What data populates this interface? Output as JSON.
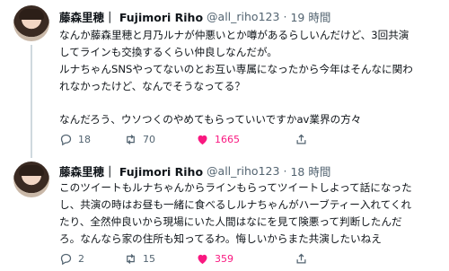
{
  "tweets": [
    {
      "author_name": "藤森里穂｜ Fujimori Riho",
      "handle": "@all_riho123",
      "time": "19 時間",
      "body_lines": [
        "なんか藤森里穂と月乃ルナが仲悪いとか噂があるらしいんだけど、3回共演",
        "してラインも交換するくらい仲良しなんだが。",
        "ルナちゃんSNSやってないのとお互い専属になったから今年はそんなに関わ",
        "れなかったけど、なんでそうなってる？",
        "",
        "なんだろう、ウソつくのやめてもらっていいですかav業界の方々"
      ],
      "replies": "18",
      "retweets": "70",
      "likes": "1665"
    },
    {
      "author_name": "藤森里穂｜ Fujimori Riho",
      "handle": "@all_riho123",
      "time": "18 時間",
      "body_lines": [
        "このツイートもルナちゃんからラインもらってツイートしよって話になった",
        "し、共演の時はお昼も一緒に食べるしルナちゃんがハーブティー入れてくれ",
        "たり、全然仲良いから現場にいた人間はなにを見て険悪って判断したんだ",
        "ろ。なんなら家の住所も知ってるわ。悔しいからまた共演したいねえ"
      ],
      "replies": "2",
      "retweets": "15",
      "likes": "359"
    }
  ],
  "icons": [
    "reply-icon",
    "retweet-icon",
    "like-icon",
    "share-icon",
    "more-icon"
  ],
  "colors": {
    "like": "#f91880",
    "meta": "#536471",
    "text": "#0f1419"
  }
}
